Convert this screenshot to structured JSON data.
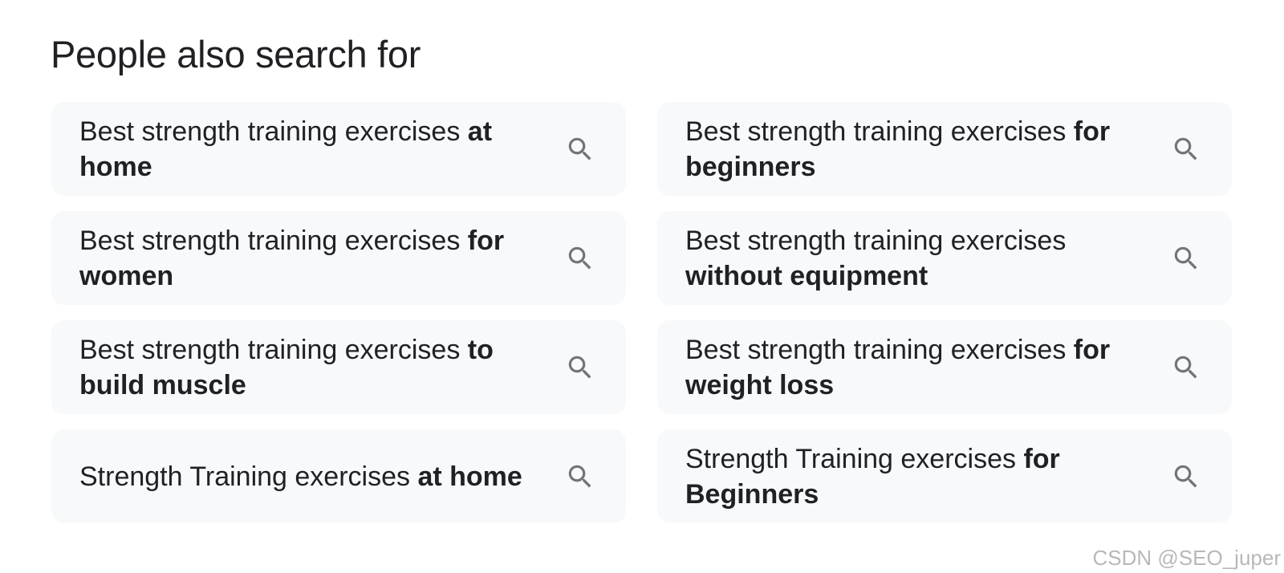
{
  "section": {
    "title": "People also search for"
  },
  "suggestions": [
    {
      "prefix": "Best strength training exercises ",
      "bold": "at home"
    },
    {
      "prefix": "Best strength training exercises ",
      "bold": "for beginners"
    },
    {
      "prefix": "Best strength training exercises ",
      "bold": "for women"
    },
    {
      "prefix": "Best strength training exercises ",
      "bold": "without equipment"
    },
    {
      "prefix": "Best strength training exercises ",
      "bold": "to build muscle"
    },
    {
      "prefix": "Best strength training exercises ",
      "bold": "for weight loss"
    },
    {
      "prefix": "Strength Training exercises ",
      "bold": "at home"
    },
    {
      "prefix": "Strength Training exercises ",
      "bold": "for Beginners"
    }
  ],
  "icons": {
    "chip_icon": "search-icon"
  },
  "colors": {
    "chip_background": "#f8f9fa",
    "text": "#202124",
    "icon": "#70757a"
  },
  "watermark": "CSDN @SEO_juper"
}
